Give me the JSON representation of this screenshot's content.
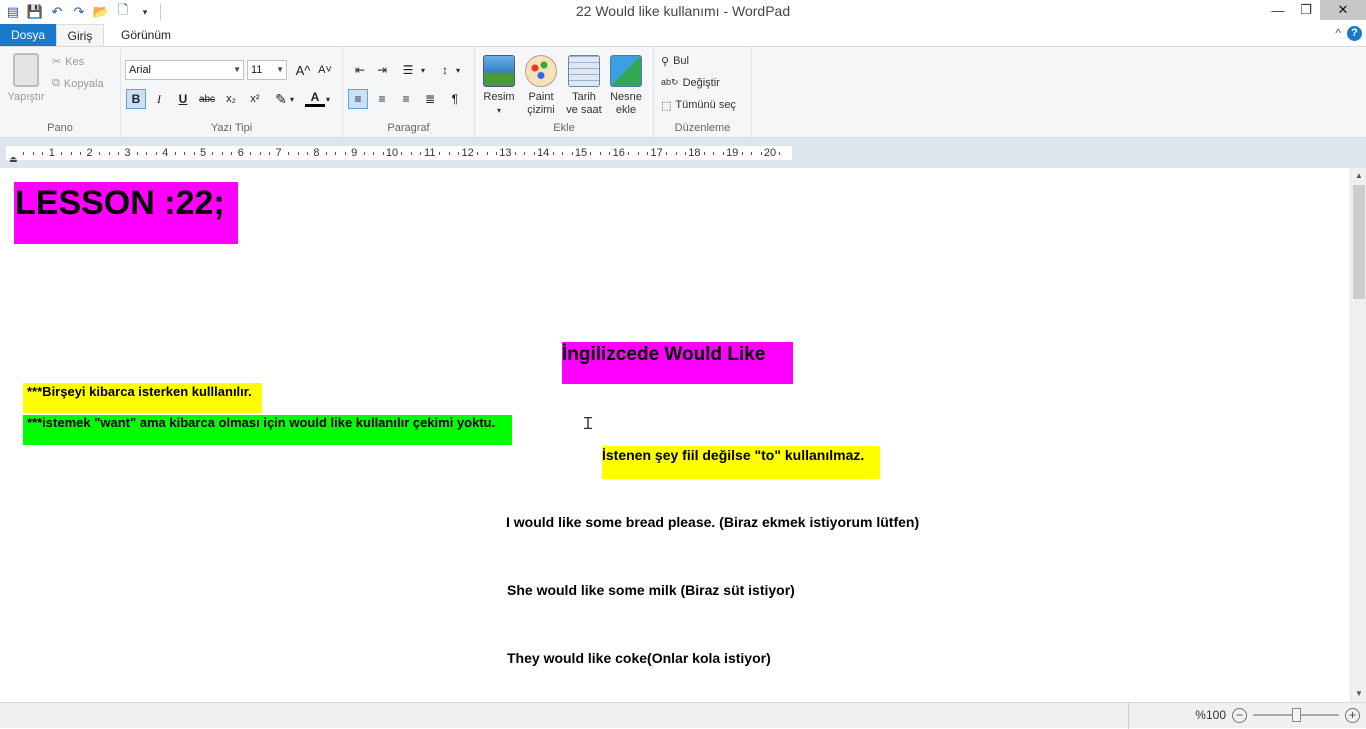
{
  "window": {
    "title": "22 Would like kullanımı - WordPad",
    "minimize": "—",
    "maximize": "❐",
    "close": "✕"
  },
  "tabs": {
    "file": "Dosya",
    "home": "Giriş",
    "view": "Görünüm",
    "collapse": "^",
    "help": "?"
  },
  "ribbon": {
    "clipboard": {
      "label": "Pano",
      "paste": "Yapıştır",
      "cut": "Kes",
      "copy": "Kopyala"
    },
    "font": {
      "label": "Yazı Tipi",
      "family": "Arial",
      "size": "11",
      "bold": "B",
      "italic": "I",
      "underline": "U",
      "strike": "abc",
      "sub": "x₂",
      "sup": "x²",
      "grow": "A^",
      "shrink": "A˅",
      "font_color": "A"
    },
    "paragraph": {
      "label": "Paragraf"
    },
    "insert": {
      "label": "Ekle",
      "picture": "Resim",
      "paint_1": "Paint",
      "paint_2": "çizimi",
      "datetime_1": "Tarih",
      "datetime_2": "ve saat",
      "object_1": "Nesne",
      "object_2": "ekle"
    },
    "editing": {
      "label": "Düzenleme",
      "find": "Bul",
      "replace": "Değiştir",
      "select_all": "Tümünü seç"
    }
  },
  "ruler": {
    "numbers": [
      "1",
      "2",
      "3",
      "4",
      "5",
      "6",
      "7",
      "8",
      "9",
      "10",
      "11",
      "12",
      "13",
      "14",
      "15",
      "16",
      "17",
      "18",
      "19",
      "20"
    ]
  },
  "document": {
    "heading": "LESSON :22;",
    "subheading": "İngilizcede Would Like",
    "note1": "***Birşeyi  kibarca isterken kulllanılır.",
    "note2": "***istemek \"want\" ama kibarca olması için would like kullanılır çekimi yoktu.",
    "note3": "İstenen şey fiil değilse \"to\" kullanılmaz.",
    "ex1": "I would like some bread please. (Biraz ekmek istiyorum lütfen)",
    "ex2": "She would like some milk   (Biraz süt  istiyor)",
    "ex3": "They would like coke(Onlar kola istiyor)"
  },
  "colors": {
    "magenta": "#ff00ff",
    "yellow": "#ffff00",
    "green": "#00ff00",
    "accent": "#1979ca"
  },
  "status": {
    "zoom": "%100",
    "zoom_out": "−",
    "zoom_in": "+"
  }
}
